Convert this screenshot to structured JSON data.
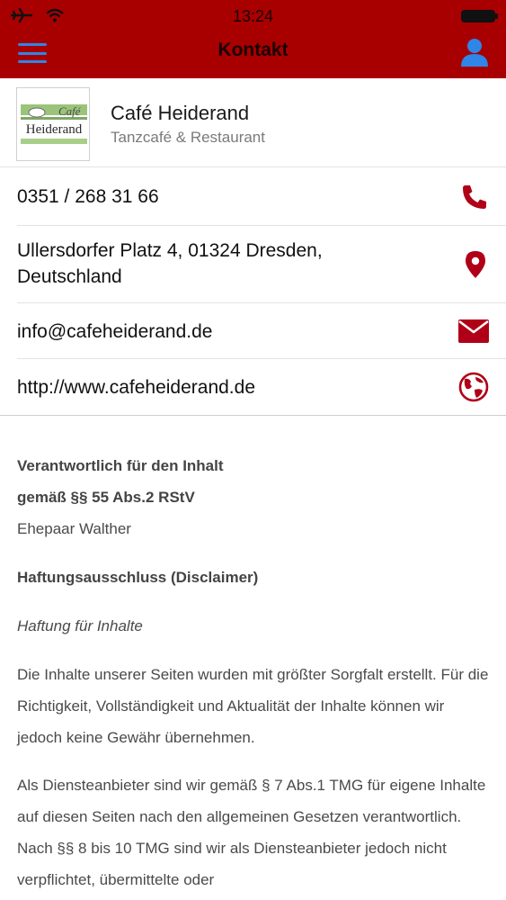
{
  "status_bar": {
    "time": "13:24"
  },
  "nav": {
    "title": "Kontakt"
  },
  "company": {
    "name": "Café Heiderand",
    "subtitle": "Tanzcafé & Restaurant",
    "logo_text_top": "Café",
    "logo_text_main": "Heiderand"
  },
  "contact": {
    "phone": "0351 / 268 31 66",
    "address": "Ullersdorfer Platz 4, 01324 Dresden, Deutschland",
    "email": "info@cafeheiderand.de",
    "website": "http://www.cafeheiderand.de"
  },
  "legal": {
    "heading_line1": "Verantwortlich für den Inhalt",
    "heading_line2": "gemäß §§ 55 Abs.2 RStV",
    "responsible": "Ehepaar Walther",
    "disclaimer_heading": "Haftungsausschluss (Disclaimer)",
    "liability_subheading": "Haftung für Inhalte",
    "paragraph1": "Die Inhalte unserer Seiten wurden mit größter Sorgfalt erstellt. Für die Richtigkeit, Vollständigkeit und Aktualität der Inhalte können wir jedoch keine Gewähr übernehmen.",
    "paragraph2": "Als Diensteanbieter sind wir gemäß § 7 Abs.1 TMG für eigene Inhalte auf diesen Seiten nach den allgemeinen Gesetzen verantwortlich. Nach §§ 8 bis 10 TMG sind wir als Diensteanbieter jedoch nicht verpflichtet, übermittelte oder"
  },
  "icons": {
    "menu": "hamburger-icon",
    "profile": "user-icon",
    "phone": "phone-icon",
    "address": "map-pin-icon",
    "email": "envelope-icon",
    "website": "globe-icon"
  },
  "colors": {
    "header": "#a80000",
    "accent_icons": "#b00018",
    "nav_icons": "#2f86e6"
  }
}
